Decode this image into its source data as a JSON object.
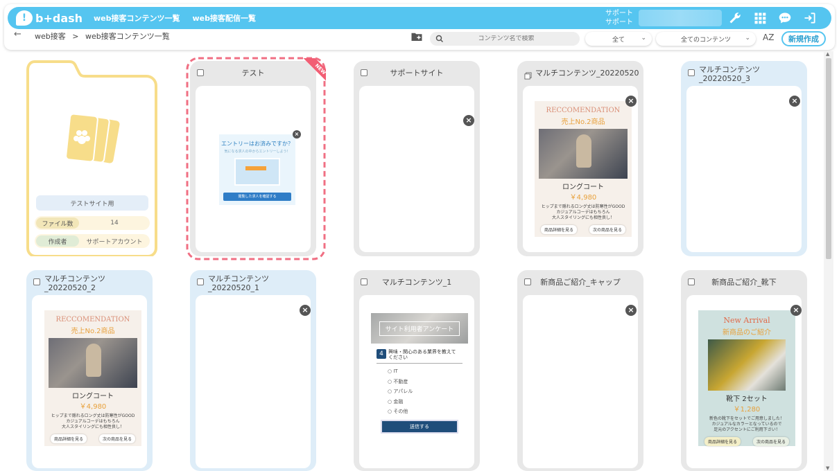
{
  "header": {
    "logo_text": "b+dash",
    "nav": [
      "web接客コンテンツ一覧",
      "web接客配信一覧"
    ],
    "support_lines": [
      "サポート",
      "サポート"
    ]
  },
  "toolbar": {
    "breadcrumb": [
      "web接客",
      ">",
      "web接客コンテンツ一覧"
    ],
    "search_placeholder": "コンテンツ名で検索",
    "filter1": "全て",
    "filter2": "全てのコンテンツ",
    "sort_label": "AZ",
    "new_button": "新規作成"
  },
  "folder": {
    "label": "テストサイト用",
    "file_count_label": "ファイル数",
    "file_count": "14",
    "creator_label": "作成者",
    "creator": "サポートアカウント"
  },
  "cards": [
    {
      "title": "テスト",
      "badge": "NEW"
    },
    {
      "title": "サポートサイト"
    },
    {
      "title": "マルチコンテンツ_20220520"
    },
    {
      "title": "マルチコンテンツ_20220520_3"
    },
    {
      "title": "マルチコンテンツ_20220520_2"
    },
    {
      "title": "マルチコンテンツ_20220520_1"
    },
    {
      "title": "マルチコンテンツ_1"
    },
    {
      "title": "新商品ご紹介_キャップ"
    },
    {
      "title": "新商品ご紹介_靴下"
    }
  ],
  "entry_banner": {
    "title": "エントリーはお済みですか？",
    "sub": "気になる求人の中からエントリーしよう！",
    "button": "閲覧した求人を確認する"
  },
  "rec": {
    "title": "RECCOMENDATION",
    "sub": "売上No.2商品",
    "name": "ロングコート",
    "price": "￥4,980",
    "desc": [
      "ヒップまで隠れるロング丈は防寒性がGOOD",
      "カジュアルコーデはもちろん",
      "大人スタイリングにも相性良し！"
    ],
    "btn1": "商品詳細を見る",
    "btn2": "次の商品を見る"
  },
  "survey": {
    "title": "サイト利用者アンケート",
    "q_num": "4",
    "question": "興味・関心のある業界を教えてください",
    "options": [
      "IT",
      "不動産",
      "アパレル",
      "金融",
      "その他"
    ],
    "submit": "送信する"
  },
  "socks": {
    "title": "New Arrival",
    "sub": "新商品のご紹介",
    "name": "靴下 2セット",
    "price": "￥1,280",
    "desc": [
      "新色の靴下をセットでご用意しました！",
      "カジュアルなカラーとなっているので",
      "足元のアクセントにご利用下さい！"
    ],
    "btn1": "商品詳細を見る",
    "btn2": "次の商品を見る"
  },
  "colors": {
    "brand": "#55c5f0",
    "folder_yellow": "#f7dd8a",
    "new_dash": "#f06f83"
  }
}
